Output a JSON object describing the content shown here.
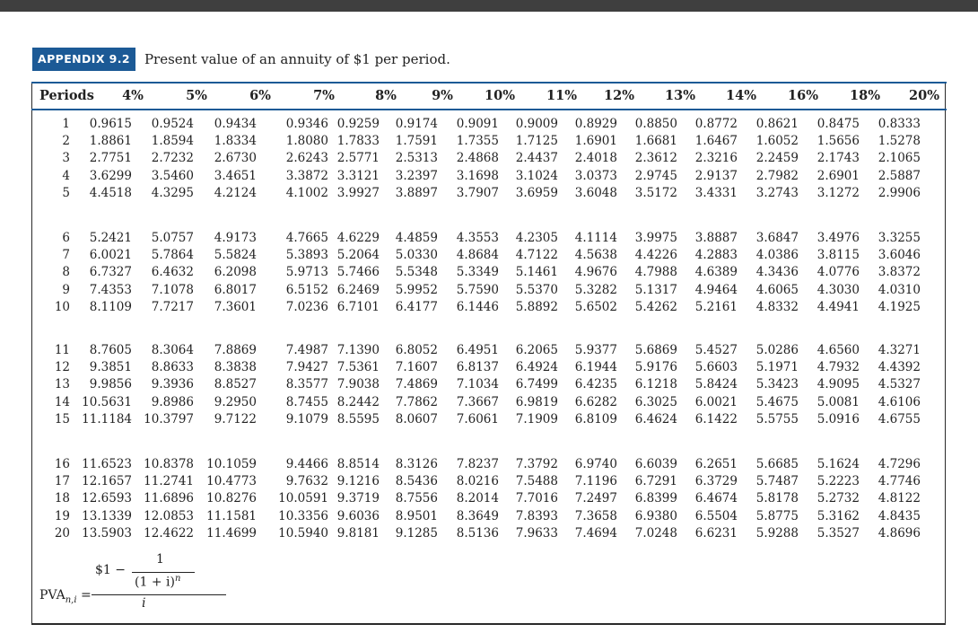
{
  "appendix": {
    "label": "APPENDIX 9.2",
    "caption": "Present value of an annuity of $1 per period."
  },
  "table": {
    "period_header": "Periods",
    "rate_headers": [
      "4%",
      "5%",
      "6%",
      "7%",
      "8%",
      "9%",
      "10%",
      "11%",
      "12%",
      "13%",
      "14%",
      "16%",
      "18%",
      "20%"
    ],
    "groups": [
      [
        {
          "period": "1",
          "values": [
            "0.9615",
            "0.9524",
            "0.9434",
            "0.9346",
            "0.9259",
            "0.9174",
            "0.9091",
            "0.9009",
            "0.8929",
            "0.8850",
            "0.8772",
            "0.8621",
            "0.8475",
            "0.8333"
          ]
        },
        {
          "period": "2",
          "values": [
            "1.8861",
            "1.8594",
            "1.8334",
            "1.8080",
            "1.7833",
            "1.7591",
            "1.7355",
            "1.7125",
            "1.6901",
            "1.6681",
            "1.6467",
            "1.6052",
            "1.5656",
            "1.5278"
          ]
        },
        {
          "period": "3",
          "values": [
            "2.7751",
            "2.7232",
            "2.6730",
            "2.6243",
            "2.5771",
            "2.5313",
            "2.4868",
            "2.4437",
            "2.4018",
            "2.3612",
            "2.3216",
            "2.2459",
            "2.1743",
            "2.1065"
          ]
        },
        {
          "period": "4",
          "values": [
            "3.6299",
            "3.5460",
            "3.4651",
            "3.3872",
            "3.3121",
            "3.2397",
            "3.1698",
            "3.1024",
            "3.0373",
            "2.9745",
            "2.9137",
            "2.7982",
            "2.6901",
            "2.5887"
          ]
        },
        {
          "period": "5",
          "values": [
            "4.4518",
            "4.3295",
            "4.2124",
            "4.1002",
            "3.9927",
            "3.8897",
            "3.7907",
            "3.6959",
            "3.6048",
            "3.5172",
            "3.4331",
            "3.2743",
            "3.1272",
            "2.9906"
          ]
        }
      ],
      [
        {
          "period": "6",
          "values": [
            "5.2421",
            "5.0757",
            "4.9173",
            "4.7665",
            "4.6229",
            "4.4859",
            "4.3553",
            "4.2305",
            "4.1114",
            "3.9975",
            "3.8887",
            "3.6847",
            "3.4976",
            "3.3255"
          ]
        },
        {
          "period": "7",
          "values": [
            "6.0021",
            "5.7864",
            "5.5824",
            "5.3893",
            "5.2064",
            "5.0330",
            "4.8684",
            "4.7122",
            "4.5638",
            "4.4226",
            "4.2883",
            "4.0386",
            "3.8115",
            "3.6046"
          ]
        },
        {
          "period": "8",
          "values": [
            "6.7327",
            "6.4632",
            "6.2098",
            "5.9713",
            "5.7466",
            "5.5348",
            "5.3349",
            "5.1461",
            "4.9676",
            "4.7988",
            "4.6389",
            "4.3436",
            "4.0776",
            "3.8372"
          ]
        },
        {
          "period": "9",
          "values": [
            "7.4353",
            "7.1078",
            "6.8017",
            "6.5152",
            "6.2469",
            "5.9952",
            "5.7590",
            "5.5370",
            "5.3282",
            "5.1317",
            "4.9464",
            "4.6065",
            "4.3030",
            "4.0310"
          ]
        },
        {
          "period": "10",
          "values": [
            "8.1109",
            "7.7217",
            "7.3601",
            "7.0236",
            "6.7101",
            "6.4177",
            "6.1446",
            "5.8892",
            "5.6502",
            "5.4262",
            "5.2161",
            "4.8332",
            "4.4941",
            "4.1925"
          ]
        }
      ],
      [
        {
          "period": "11",
          "values": [
            "8.7605",
            "8.3064",
            "7.8869",
            "7.4987",
            "7.1390",
            "6.8052",
            "6.4951",
            "6.2065",
            "5.9377",
            "5.6869",
            "5.4527",
            "5.0286",
            "4.6560",
            "4.3271"
          ]
        },
        {
          "period": "12",
          "values": [
            "9.3851",
            "8.8633",
            "8.3838",
            "7.9427",
            "7.5361",
            "7.1607",
            "6.8137",
            "6.4924",
            "6.1944",
            "5.9176",
            "5.6603",
            "5.1971",
            "4.7932",
            "4.4392"
          ]
        },
        {
          "period": "13",
          "values": [
            "9.9856",
            "9.3936",
            "8.8527",
            "8.3577",
            "7.9038",
            "7.4869",
            "7.1034",
            "6.7499",
            "6.4235",
            "6.1218",
            "5.8424",
            "5.3423",
            "4.9095",
            "4.5327"
          ]
        },
        {
          "period": "14",
          "values": [
            "10.5631",
            "9.8986",
            "9.2950",
            "8.7455",
            "8.2442",
            "7.7862",
            "7.3667",
            "6.9819",
            "6.6282",
            "6.3025",
            "6.0021",
            "5.4675",
            "5.0081",
            "4.6106"
          ]
        },
        {
          "period": "15",
          "values": [
            "11.1184",
            "10.3797",
            "9.7122",
            "9.1079",
            "8.5595",
            "8.0607",
            "7.6061",
            "7.1909",
            "6.8109",
            "6.4624",
            "6.1422",
            "5.5755",
            "5.0916",
            "4.6755"
          ]
        }
      ],
      [
        {
          "period": "16",
          "values": [
            "11.6523",
            "10.8378",
            "10.1059",
            "9.4466",
            "8.8514",
            "8.3126",
            "7.8237",
            "7.3792",
            "6.9740",
            "6.6039",
            "6.2651",
            "5.6685",
            "5.1624",
            "4.7296"
          ]
        },
        {
          "period": "17",
          "values": [
            "12.1657",
            "11.2741",
            "10.4773",
            "9.7632",
            "9.1216",
            "8.5436",
            "8.0216",
            "7.5488",
            "7.1196",
            "6.7291",
            "6.3729",
            "5.7487",
            "5.2223",
            "4.7746"
          ]
        },
        {
          "period": "18",
          "values": [
            "12.6593",
            "11.6896",
            "10.8276",
            "10.0591",
            "9.3719",
            "8.7556",
            "8.2014",
            "7.7016",
            "7.2497",
            "6.8399",
            "6.4674",
            "5.8178",
            "5.2732",
            "4.8122"
          ]
        },
        {
          "period": "19",
          "values": [
            "13.1339",
            "12.0853",
            "11.1581",
            "10.3356",
            "9.6036",
            "8.9501",
            "8.3649",
            "7.8393",
            "7.3658",
            "6.9380",
            "6.5504",
            "5.8775",
            "5.3162",
            "4.8435"
          ]
        },
        {
          "period": "20",
          "values": [
            "13.5903",
            "12.4622",
            "11.4699",
            "10.5940",
            "9.8181",
            "9.1285",
            "8.5136",
            "7.9633",
            "7.4694",
            "7.0248",
            "6.6231",
            "5.9288",
            "5.3527",
            "4.8696"
          ]
        }
      ]
    ]
  },
  "formula": {
    "lhs": "PVA",
    "lhs_sub": "n,i",
    "eq": "=",
    "dollar": "$1 −",
    "one": "1",
    "denominator": "(1 + i)",
    "exponent": "n",
    "divisor": "i"
  },
  "colors": {
    "accent": "#1c5a96",
    "topbar": "#3f3f3f"
  }
}
